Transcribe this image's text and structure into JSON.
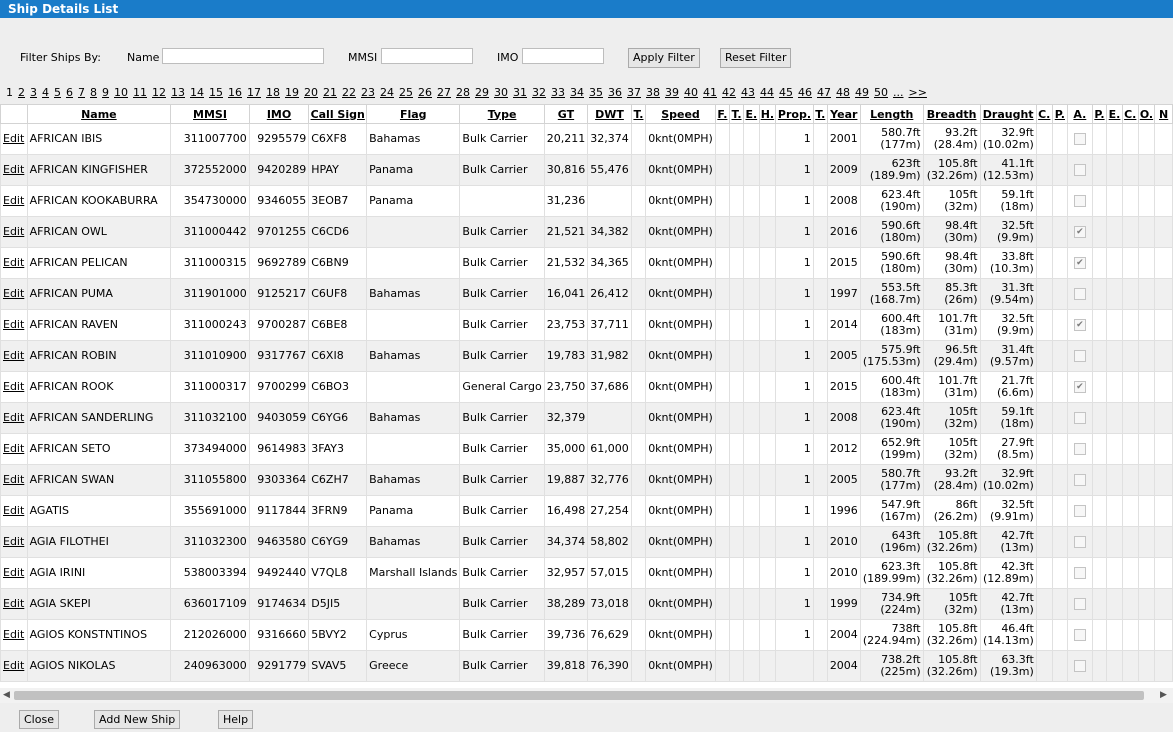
{
  "window": {
    "title": "Ship Details List"
  },
  "filter": {
    "label": "Filter Ships By:",
    "name_label": "Name",
    "name_value": "",
    "mmsi_label": "MMSI",
    "mmsi_value": "",
    "imo_label": "IMO",
    "imo_value": "",
    "apply_label": "Apply Filter",
    "reset_label": "Reset Filter"
  },
  "pager": {
    "current": "1",
    "pages": [
      "2",
      "3",
      "4",
      "5",
      "6",
      "7",
      "8",
      "9",
      "10",
      "11",
      "12",
      "13",
      "14",
      "15",
      "16",
      "17",
      "18",
      "19",
      "20",
      "21",
      "22",
      "23",
      "24",
      "25",
      "26",
      "27",
      "28",
      "29",
      "30",
      "31",
      "32",
      "33",
      "34",
      "35",
      "36",
      "37",
      "38",
      "39",
      "40",
      "41",
      "42",
      "43",
      "44",
      "45",
      "46",
      "47",
      "48",
      "49",
      "50",
      "...",
      ">>"
    ]
  },
  "grid": {
    "columns": [
      "",
      "Name",
      "MMSI",
      "IMO",
      "Call Sign",
      "Flag",
      "Type",
      "GT",
      "DWT",
      "T.",
      "Speed",
      "F.",
      "T.",
      "E.",
      "H.",
      "Prop.",
      "T.",
      "Year",
      "Length",
      "Breadth",
      "Draught",
      "C.",
      "P.",
      "A.",
      "P.",
      "E.",
      "C.",
      "O.",
      "N"
    ],
    "edit_label": "Edit",
    "rows": [
      {
        "name": "AFRICAN IBIS",
        "mmsi": "311007700",
        "imo": "9295579",
        "callsign": "C6XF8",
        "flag": "Bahamas",
        "type": "Bulk Carrier",
        "gt": "20,211",
        "dwt": "32,374",
        "speed": "0knt(0MPH)",
        "prop": "1",
        "year": "2001",
        "length_ft": "580.7ft",
        "length_m": "(177m)",
        "breadth_ft": "93.2ft",
        "breadth_m": "(28.4m)",
        "draught_ft": "32.9ft",
        "draught_m": "(10.02m)",
        "a_checked": false
      },
      {
        "name": "AFRICAN KINGFISHER",
        "mmsi": "372552000",
        "imo": "9420289",
        "callsign": "HPAY",
        "flag": "Panama",
        "type": "Bulk Carrier",
        "gt": "30,816",
        "dwt": "55,476",
        "speed": "0knt(0MPH)",
        "prop": "1",
        "year": "2009",
        "length_ft": "623ft",
        "length_m": "(189.9m)",
        "breadth_ft": "105.8ft",
        "breadth_m": "(32.26m)",
        "draught_ft": "41.1ft",
        "draught_m": "(12.53m)",
        "a_checked": false
      },
      {
        "name": "AFRICAN KOOKABURRA",
        "mmsi": "354730000",
        "imo": "9346055",
        "callsign": "3EOB7",
        "flag": "Panama",
        "type": "",
        "gt": "31,236",
        "dwt": "",
        "speed": "0knt(0MPH)",
        "prop": "1",
        "year": "2008",
        "length_ft": "623.4ft",
        "length_m": "(190m)",
        "breadth_ft": "105ft",
        "breadth_m": "(32m)",
        "draught_ft": "59.1ft",
        "draught_m": "(18m)",
        "a_checked": false
      },
      {
        "name": "AFRICAN OWL",
        "mmsi": "311000442",
        "imo": "9701255",
        "callsign": "C6CD6",
        "flag": "",
        "type": "Bulk Carrier",
        "gt": "21,521",
        "dwt": "34,382",
        "speed": "0knt(0MPH)",
        "prop": "1",
        "year": "2016",
        "length_ft": "590.6ft",
        "length_m": "(180m)",
        "breadth_ft": "98.4ft",
        "breadth_m": "(30m)",
        "draught_ft": "32.5ft",
        "draught_m": "(9.9m)",
        "a_checked": true
      },
      {
        "name": "AFRICAN PELICAN",
        "mmsi": "311000315",
        "imo": "9692789",
        "callsign": "C6BN9",
        "flag": "",
        "type": "Bulk Carrier",
        "gt": "21,532",
        "dwt": "34,365",
        "speed": "0knt(0MPH)",
        "prop": "1",
        "year": "2015",
        "length_ft": "590.6ft",
        "length_m": "(180m)",
        "breadth_ft": "98.4ft",
        "breadth_m": "(30m)",
        "draught_ft": "33.8ft",
        "draught_m": "(10.3m)",
        "a_checked": true
      },
      {
        "name": "AFRICAN PUMA",
        "mmsi": "311901000",
        "imo": "9125217",
        "callsign": "C6UF8",
        "flag": "Bahamas",
        "type": "Bulk Carrier",
        "gt": "16,041",
        "dwt": "26,412",
        "speed": "0knt(0MPH)",
        "prop": "1",
        "year": "1997",
        "length_ft": "553.5ft",
        "length_m": "(168.7m)",
        "breadth_ft": "85.3ft",
        "breadth_m": "(26m)",
        "draught_ft": "31.3ft",
        "draught_m": "(9.54m)",
        "a_checked": false
      },
      {
        "name": "AFRICAN RAVEN",
        "mmsi": "311000243",
        "imo": "9700287",
        "callsign": "C6BE8",
        "flag": "",
        "type": "Bulk Carrier",
        "gt": "23,753",
        "dwt": "37,711",
        "speed": "0knt(0MPH)",
        "prop": "1",
        "year": "2014",
        "length_ft": "600.4ft",
        "length_m": "(183m)",
        "breadth_ft": "101.7ft",
        "breadth_m": "(31m)",
        "draught_ft": "32.5ft",
        "draught_m": "(9.9m)",
        "a_checked": true
      },
      {
        "name": "AFRICAN ROBIN",
        "mmsi": "311010900",
        "imo": "9317767",
        "callsign": "C6XI8",
        "flag": "Bahamas",
        "type": "Bulk Carrier",
        "gt": "19,783",
        "dwt": "31,982",
        "speed": "0knt(0MPH)",
        "prop": "1",
        "year": "2005",
        "length_ft": "575.9ft",
        "length_m": "(175.53m)",
        "breadth_ft": "96.5ft",
        "breadth_m": "(29.4m)",
        "draught_ft": "31.4ft",
        "draught_m": "(9.57m)",
        "a_checked": false
      },
      {
        "name": "AFRICAN ROOK",
        "mmsi": "311000317",
        "imo": "9700299",
        "callsign": "C6BO3",
        "flag": "",
        "type": "General Cargo",
        "gt": "23,750",
        "dwt": "37,686",
        "speed": "0knt(0MPH)",
        "prop": "1",
        "year": "2015",
        "length_ft": "600.4ft",
        "length_m": "(183m)",
        "breadth_ft": "101.7ft",
        "breadth_m": "(31m)",
        "draught_ft": "21.7ft",
        "draught_m": "(6.6m)",
        "a_checked": true
      },
      {
        "name": "AFRICAN SANDERLING",
        "mmsi": "311032100",
        "imo": "9403059",
        "callsign": "C6YG6",
        "flag": "Bahamas",
        "type": "Bulk Carrier",
        "gt": "32,379",
        "dwt": "",
        "speed": "0knt(0MPH)",
        "prop": "1",
        "year": "2008",
        "length_ft": "623.4ft",
        "length_m": "(190m)",
        "breadth_ft": "105ft",
        "breadth_m": "(32m)",
        "draught_ft": "59.1ft",
        "draught_m": "(18m)",
        "a_checked": false
      },
      {
        "name": "AFRICAN SETO",
        "mmsi": "373494000",
        "imo": "9614983",
        "callsign": "3FAY3",
        "flag": "",
        "type": "Bulk Carrier",
        "gt": "35,000",
        "dwt": "61,000",
        "speed": "0knt(0MPH)",
        "prop": "1",
        "year": "2012",
        "length_ft": "652.9ft",
        "length_m": "(199m)",
        "breadth_ft": "105ft",
        "breadth_m": "(32m)",
        "draught_ft": "27.9ft",
        "draught_m": "(8.5m)",
        "a_checked": false
      },
      {
        "name": "AFRICAN SWAN",
        "mmsi": "311055800",
        "imo": "9303364",
        "callsign": "C6ZH7",
        "flag": "Bahamas",
        "type": "Bulk Carrier",
        "gt": "19,887",
        "dwt": "32,776",
        "speed": "0knt(0MPH)",
        "prop": "1",
        "year": "2005",
        "length_ft": "580.7ft",
        "length_m": "(177m)",
        "breadth_ft": "93.2ft",
        "breadth_m": "(28.4m)",
        "draught_ft": "32.9ft",
        "draught_m": "(10.02m)",
        "a_checked": false
      },
      {
        "name": "AGATIS",
        "mmsi": "355691000",
        "imo": "9117844",
        "callsign": "3FRN9",
        "flag": "Panama",
        "type": "Bulk Carrier",
        "gt": "16,498",
        "dwt": "27,254",
        "speed": "0knt(0MPH)",
        "prop": "1",
        "year": "1996",
        "length_ft": "547.9ft",
        "length_m": "(167m)",
        "breadth_ft": "86ft",
        "breadth_m": "(26.2m)",
        "draught_ft": "32.5ft",
        "draught_m": "(9.91m)",
        "a_checked": false
      },
      {
        "name": "AGIA FILOTHEI",
        "mmsi": "311032300",
        "imo": "9463580",
        "callsign": "C6YG9",
        "flag": "Bahamas",
        "type": "Bulk Carrier",
        "gt": "34,374",
        "dwt": "58,802",
        "speed": "0knt(0MPH)",
        "prop": "1",
        "year": "2010",
        "length_ft": "643ft",
        "length_m": "(196m)",
        "breadth_ft": "105.8ft",
        "breadth_m": "(32.26m)",
        "draught_ft": "42.7ft",
        "draught_m": "(13m)",
        "a_checked": false
      },
      {
        "name": "AGIA IRINI",
        "mmsi": "538003394",
        "imo": "9492440",
        "callsign": "V7QL8",
        "flag": "Marshall Islands",
        "type": "Bulk Carrier",
        "gt": "32,957",
        "dwt": "57,015",
        "speed": "0knt(0MPH)",
        "prop": "1",
        "year": "2010",
        "length_ft": "623.3ft",
        "length_m": "(189.99m)",
        "breadth_ft": "105.8ft",
        "breadth_m": "(32.26m)",
        "draught_ft": "42.3ft",
        "draught_m": "(12.89m)",
        "a_checked": false
      },
      {
        "name": "AGIA SKEPI",
        "mmsi": "636017109",
        "imo": "9174634",
        "callsign": "D5JI5",
        "flag": "",
        "type": "Bulk Carrier",
        "gt": "38,289",
        "dwt": "73,018",
        "speed": "0knt(0MPH)",
        "prop": "1",
        "year": "1999",
        "length_ft": "734.9ft",
        "length_m": "(224m)",
        "breadth_ft": "105ft",
        "breadth_m": "(32m)",
        "draught_ft": "42.7ft",
        "draught_m": "(13m)",
        "a_checked": false
      },
      {
        "name": "AGIOS KONSTNTINOS",
        "mmsi": "212026000",
        "imo": "9316660",
        "callsign": "5BVY2",
        "flag": "Cyprus",
        "type": "Bulk Carrier",
        "gt": "39,736",
        "dwt": "76,629",
        "speed": "0knt(0MPH)",
        "prop": "1",
        "year": "2004",
        "length_ft": "738ft",
        "length_m": "(224.94m)",
        "breadth_ft": "105.8ft",
        "breadth_m": "(32.26m)",
        "draught_ft": "46.4ft",
        "draught_m": "(14.13m)",
        "a_checked": false
      },
      {
        "name": "AGIOS NIKOLAS",
        "mmsi": "240963000",
        "imo": "9291779",
        "callsign": "SVAV5",
        "flag": "Greece",
        "type": "Bulk Carrier",
        "gt": "39,818",
        "dwt": "76,390",
        "speed": "0knt(0MPH)",
        "prop": "",
        "year": "2004",
        "length_ft": "738.2ft",
        "length_m": "(225m)",
        "breadth_ft": "105.8ft",
        "breadth_m": "(32.26m)",
        "draught_ft": "63.3ft",
        "draught_m": "(19.3m)",
        "a_checked": false
      }
    ]
  },
  "footer": {
    "close_label": "Close",
    "add_label": "Add New Ship",
    "help_label": "Help"
  }
}
